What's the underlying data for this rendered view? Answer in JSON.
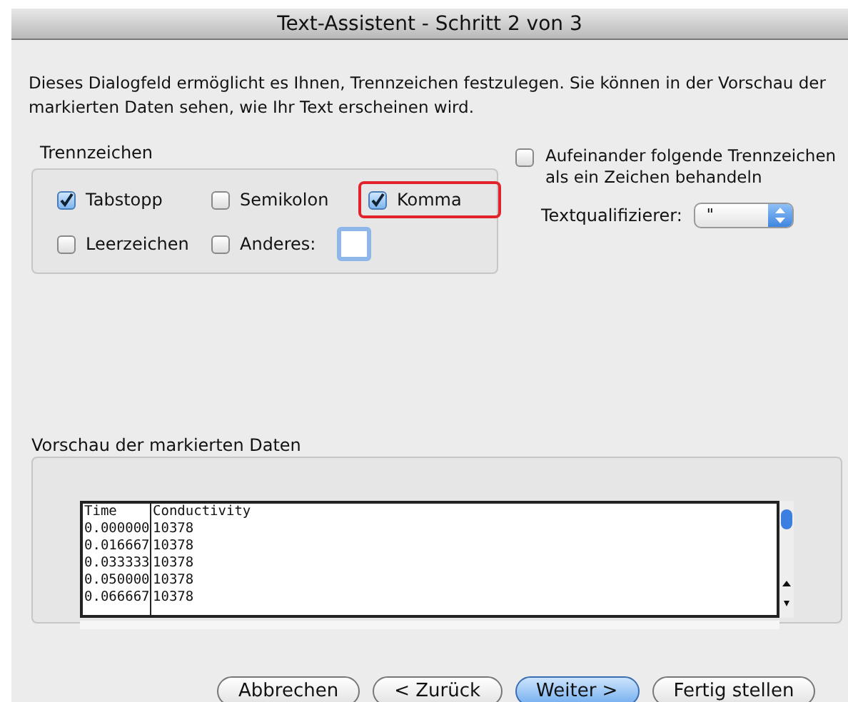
{
  "window": {
    "title": "Text-Assistent - Schritt 2 von 3"
  },
  "description": "Dieses Dialogfeld ermöglicht es Ihnen, Trennzeichen festzulegen. Sie können in der Vorschau der markierten Daten sehen, wie Ihr Text erscheinen wird.",
  "delimiters": {
    "title": "Trennzeichen",
    "options": [
      {
        "label": "Tabstopp",
        "checked": true,
        "highlighted": false
      },
      {
        "label": "Semikolon",
        "checked": false,
        "highlighted": false
      },
      {
        "label": "Komma",
        "checked": true,
        "highlighted": true
      },
      {
        "label": "Leerzeichen",
        "checked": false,
        "highlighted": false
      },
      {
        "label": "Anderes:",
        "checked": false,
        "highlighted": false
      }
    ]
  },
  "consecutive": {
    "label": "Aufeinander folgende Trennzeichen als ein Zeichen behandeln",
    "checked": false
  },
  "qualifier": {
    "label": "Textqualifizierer:",
    "value": "\""
  },
  "preview": {
    "title": "Vorschau der markierten Daten",
    "columns": [
      "Time",
      "Conductivity"
    ],
    "rows": [
      [
        "0.000000",
        "10378"
      ],
      [
        "0.016667",
        "10378"
      ],
      [
        "0.033333",
        "10378"
      ],
      [
        "0.050000",
        "10378"
      ],
      [
        "0.066667",
        "10378"
      ]
    ]
  },
  "buttons": [
    {
      "label": "Abbrechen",
      "default": false
    },
    {
      "label": "< Zurück",
      "default": false
    },
    {
      "label": "Weiter >",
      "default": true
    },
    {
      "label": "Fertig stellen",
      "default": false
    }
  ]
}
